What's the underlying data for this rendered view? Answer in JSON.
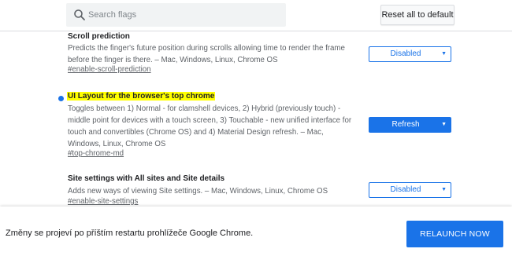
{
  "search": {
    "placeholder": "Search flags",
    "icon": "search-icon"
  },
  "header": {
    "reset_label": "Reset all to default"
  },
  "flags": [
    {
      "title": "Scroll prediction",
      "description": "Predicts the finger's future position during scrolls allowing time to render the frame before the finger is there. – Mac, Windows, Linux, Chrome OS",
      "link": "#enable-scroll-prediction",
      "value": "Disabled",
      "modified": false,
      "highlighted": false
    },
    {
      "title": "UI Layout for the browser's top chrome",
      "description": "Toggles between 1) Normal - for clamshell devices, 2) Hybrid (previously touch) - middle point for devices with a touch screen, 3) Touchable - new unified interface for touch and convertibles (Chrome OS) and 4) Material Design refresh. – Mac, Windows, Linux, Chrome OS",
      "link": "#top-chrome-md",
      "value": "Refresh",
      "modified": true,
      "highlighted": true
    },
    {
      "title": "Site settings with All sites and Site details",
      "description": "Adds new ways of viewing Site settings. – Mac, Windows, Linux, Chrome OS",
      "link": "#enable-site-settings",
      "value": "Disabled",
      "modified": false,
      "highlighted": false
    }
  ],
  "footer": {
    "message": "Změny se projeví po příštím restartu prohlížeče Google Chrome.",
    "relaunch_label": "RELAUNCH NOW"
  },
  "colors": {
    "accent": "#1a73e8",
    "highlight": "#ffff00",
    "secondary_text": "#5f6368"
  }
}
